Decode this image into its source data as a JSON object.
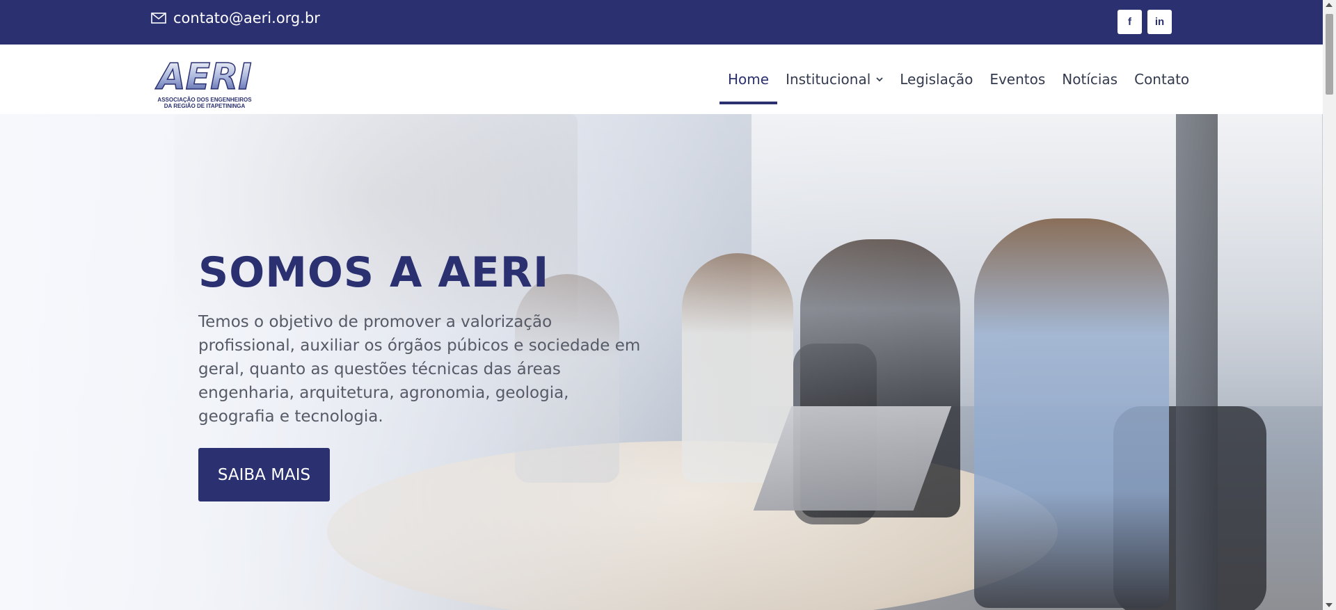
{
  "topbar": {
    "email": "contato@aeri.org.br",
    "email_icon": "mail-icon",
    "socials": [
      {
        "icon": "facebook-icon",
        "label": "f"
      },
      {
        "icon": "linkedin-icon",
        "label": "in"
      }
    ]
  },
  "header": {
    "logo": {
      "wordmark": "AERI",
      "line1": "ASSOCIAÇÃO DOS ENGENHEIROS",
      "line2": "DA REGIÃO DE ITAPETININGA"
    },
    "nav": [
      {
        "label": "Home",
        "active": true
      },
      {
        "label": "Institucional",
        "dropdown": true
      },
      {
        "label": "Legislação"
      },
      {
        "label": "Eventos"
      },
      {
        "label": "Notícias"
      },
      {
        "label": "Contato"
      }
    ]
  },
  "hero": {
    "title": "SOMOS A AERI",
    "text": "Temos o objetivo de promover a valorização profissional, auxiliar os órgãos púbicos e sociedade em geral, quanto as questões técnicas das áreas engenharia, arquitetura, agronomia, geologia, geografia e tecnologia.",
    "button": "SAIBA MAIS"
  },
  "colors": {
    "brand": "#2a3070",
    "text": "#555a66",
    "nav_text": "#333a4d"
  }
}
